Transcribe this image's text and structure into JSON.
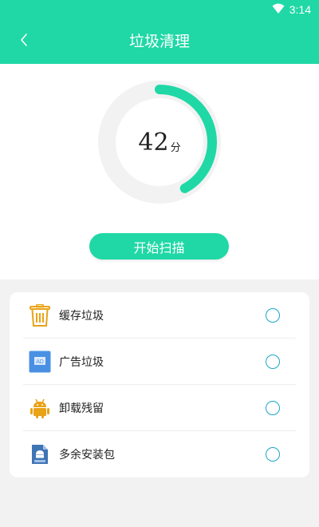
{
  "status_bar": {
    "time": "3:14",
    "wifi_icon": "wifi-icon"
  },
  "header": {
    "title": "垃圾清理",
    "back_icon": "chevron-left-icon"
  },
  "score": {
    "value": "42",
    "unit": "分",
    "progress_fraction": 0.42
  },
  "scan_button": {
    "label": "开始扫描"
  },
  "items": [
    {
      "label": "缓存垃圾",
      "icon": "trash-bin-icon"
    },
    {
      "label": "广告垃圾",
      "icon": "ad-icon"
    },
    {
      "label": "卸载残留",
      "icon": "android-icon"
    },
    {
      "label": "多余安装包",
      "icon": "apk-file-icon"
    }
  ],
  "colors": {
    "accent": "#1fd8a6",
    "ring_track": "#f2f2f2",
    "radio_border": "#1aa7c9"
  }
}
